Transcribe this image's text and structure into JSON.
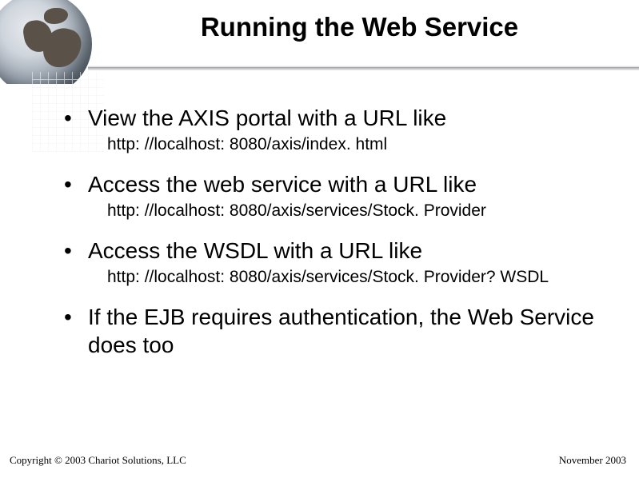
{
  "title": "Running the Web Service",
  "bullets": [
    {
      "text": "View the AXIS portal with a URL like",
      "sub": "http: //localhost: 8080/axis/index. html"
    },
    {
      "text": "Access the web service with a URL like",
      "sub": "http: //localhost: 8080/axis/services/Stock. Provider"
    },
    {
      "text": "Access the WSDL with a URL like",
      "sub": "http: //localhost: 8080/axis/services/Stock. Provider? WSDL"
    },
    {
      "text": "If the EJB requires authentication, the Web Service does too",
      "sub": ""
    }
  ],
  "footer": {
    "left": "Copyright © 2003 Chariot Solutions, LLC",
    "right": "November 2003"
  }
}
